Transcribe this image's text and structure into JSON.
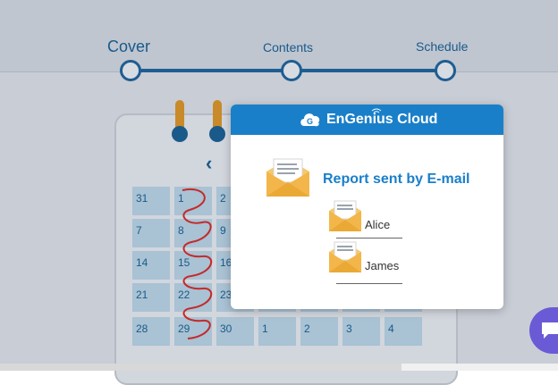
{
  "steps": {
    "cover": "Cover",
    "contents": "Contents",
    "schedule": "Schedule"
  },
  "calendar": {
    "rows": [
      [
        "31",
        "1",
        "2",
        "",
        "",
        "",
        ""
      ],
      [
        "7",
        "8",
        "9",
        "",
        "",
        "",
        ""
      ],
      [
        "14",
        "15",
        "16",
        "",
        "",
        "",
        ""
      ],
      [
        "21",
        "22",
        "23",
        "",
        "",
        "",
        ""
      ],
      [
        "28",
        "29",
        "30",
        "1",
        "2",
        "3",
        "4"
      ]
    ]
  },
  "modal": {
    "brand": "EnGenius Cloud",
    "title": "Report sent by E-mail",
    "recipients": [
      "Alice",
      "James"
    ]
  },
  "colors": {
    "brand_blue": "#1a7fc9",
    "step_blue": "#1f5d91",
    "chat_purple": "#6a5ad6"
  }
}
